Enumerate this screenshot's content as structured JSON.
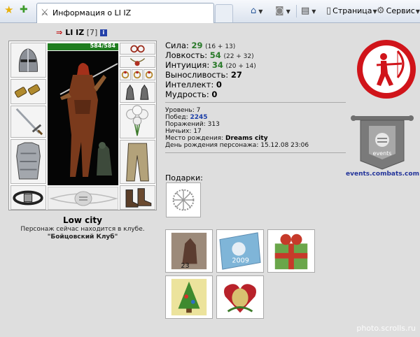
{
  "browser": {
    "tab_title": "Информация о LI IZ",
    "toolbar": {
      "page_label": "Страница",
      "service_label": "Сервис"
    },
    "icons": [
      "favorites-star-icon",
      "add-favorites-icon",
      "home-icon",
      "rss-icon",
      "print-icon",
      "page-icon",
      "gear-icon"
    ]
  },
  "character": {
    "name": "LI IZ",
    "level": "[7]",
    "hp": "584/584",
    "location": "Low city",
    "club_status": "Персонаж сейчас находится в клубе.",
    "club_name": "\"Бойцовский Клуб\""
  },
  "stats": [
    {
      "label": "Сила:",
      "value": "29",
      "bonus": "(16 + 13)",
      "color": "#2a7a2a"
    },
    {
      "label": "Ловкость:",
      "value": "54",
      "bonus": "(22 + 32)",
      "color": "#2a7a2a"
    },
    {
      "label": "Интуиция:",
      "value": "34",
      "bonus": "(20 + 14)",
      "color": "#2a7a2a"
    },
    {
      "label": "Выносливость:",
      "value": "27",
      "bonus": "",
      "color": "#000000"
    },
    {
      "label": "Интеллект:",
      "value": "0",
      "bonus": "",
      "color": "#000000"
    },
    {
      "label": "Мудрость:",
      "value": "0",
      "bonus": "",
      "color": "#000000"
    }
  ],
  "info": {
    "level_label": "Уровень:",
    "level_value": "7",
    "wins_label": "Побед:",
    "wins_value": "2245",
    "losses_label": "Поражений:",
    "losses_value": "313",
    "draws_label": "Ничьих:",
    "draws_value": "17",
    "birthplace_label": "Место рождения:",
    "birthplace_value": "Dreams city",
    "birthday_label": "День рождения персонажа:",
    "birthday_value": "15.12.08 23:06"
  },
  "gifts": {
    "label": "Подарки:",
    "items": [
      "snowflake-gift",
      "knight-card-gift",
      "new-year-2009-card-gift",
      "giftbox-gift",
      "christmas-tree-gift",
      "heart-gift"
    ]
  },
  "events": {
    "link_text": "events.combats.com",
    "badge_text": "events"
  },
  "watermark": "photo.scrolls.ru",
  "colors": {
    "accent_green": "#2a7a2a",
    "link_blue": "#1c3fa8",
    "clan_red": "#d0141a"
  }
}
